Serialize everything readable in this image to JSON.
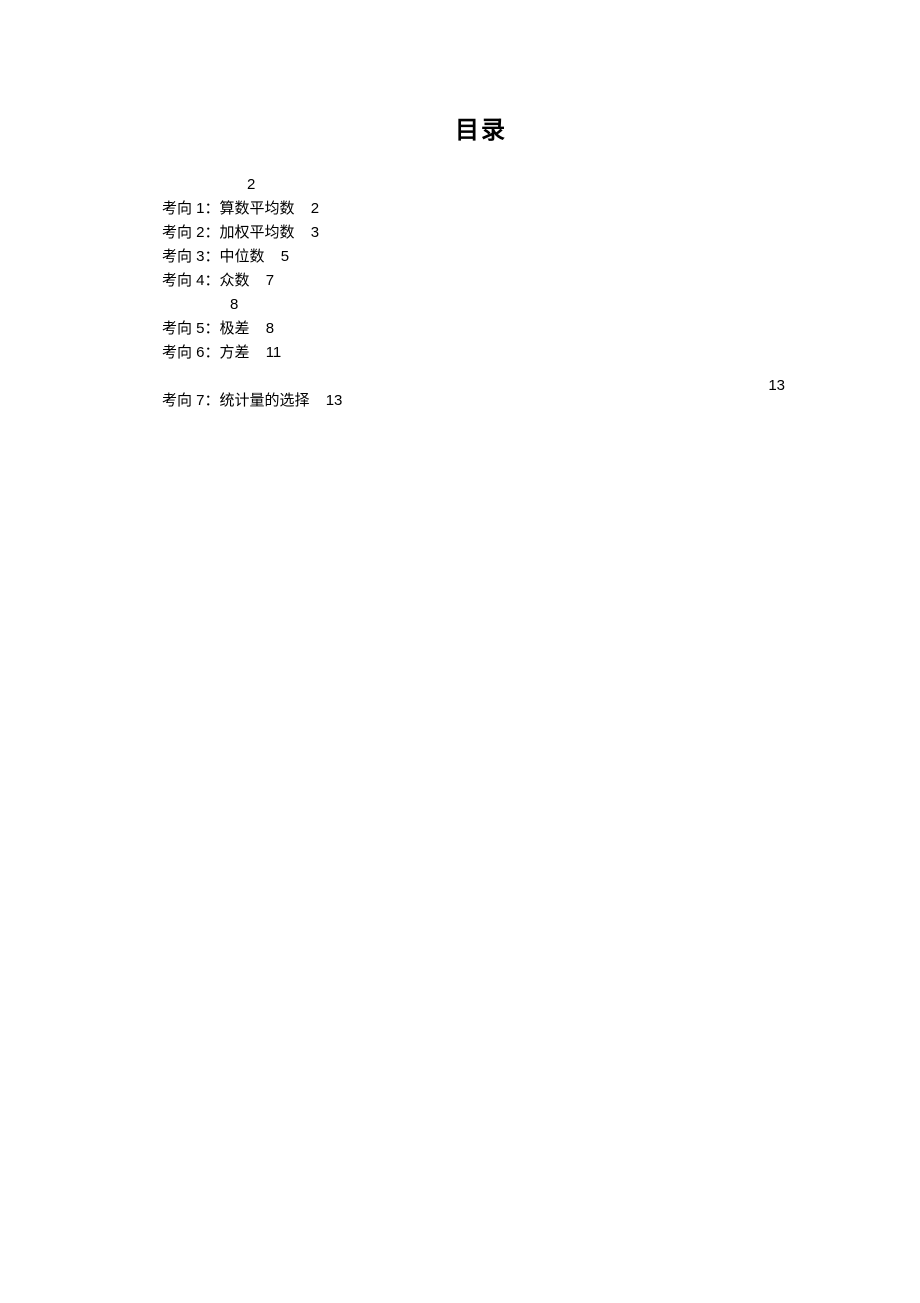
{
  "title": "目录",
  "toc": {
    "section1_page": "2",
    "items1": [
      {
        "label": "考向 1：算数平均数",
        "page": "2"
      },
      {
        "label": "考向 2：加权平均数",
        "page": "3"
      },
      {
        "label": "考向 3：中位数",
        "page": "5"
      },
      {
        "label": "考向 4：众数",
        "page": "7"
      }
    ],
    "section2_page": "8",
    "items2": [
      {
        "label": "考向 5：极差",
        "page": "8"
      },
      {
        "label": "考向 6：方差",
        "page": "11"
      }
    ],
    "right_page": "13",
    "items3": [
      {
        "label": "考向 7：统计量的选择",
        "page": "13"
      }
    ]
  }
}
